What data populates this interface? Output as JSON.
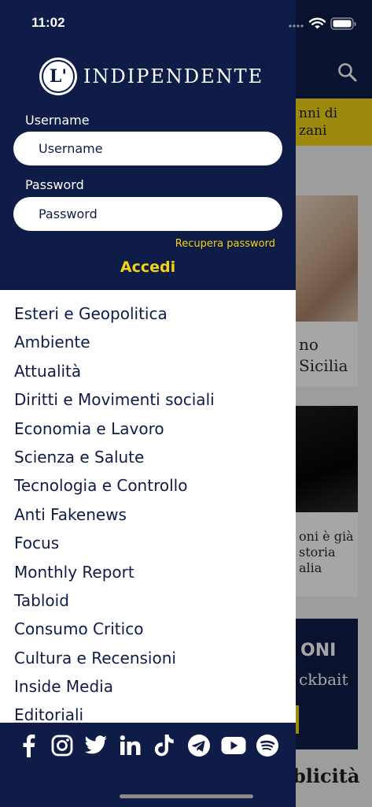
{
  "status_bar": {
    "time": "11:02"
  },
  "drawer": {
    "logo": {
      "mark": "L'",
      "text": "INDIPENDENTE"
    },
    "login": {
      "username_label": "Username",
      "username_placeholder": "Username",
      "password_label": "Password",
      "password_placeholder": "Password",
      "recover_label": "Recupera password",
      "submit_label": "Accedi"
    },
    "menu_items": [
      "Esteri e Geopolitica",
      "Ambiente",
      "Attualità",
      "Diritti e Movimenti sociali",
      "Economia e Lavoro",
      "Scienza e Salute",
      "Tecnologia e Controllo",
      "Anti Fakenews",
      "Focus",
      "Monthly Report",
      "Tabloid",
      "Consumo Critico",
      "Cultura e Recensioni",
      "Inside Media",
      "Editoriali"
    ],
    "social_icons": [
      "facebook-icon",
      "instagram-icon",
      "twitter-icon",
      "linkedin-icon",
      "tiktok-icon",
      "telegram-icon",
      "youtube-icon",
      "spotify-icon"
    ]
  },
  "background": {
    "banner_text": [
      "nni di",
      "zani"
    ],
    "card1_title": [
      "no",
      "Sicilia"
    ],
    "card2_title": [
      "oni è già",
      "storia",
      "alia"
    ],
    "promo_title": "ONI",
    "promo_sub": "ckbait",
    "bottom_text": "blicità"
  },
  "colors": {
    "navy": "#0f1c48",
    "accent_yellow": "#f2d316",
    "white": "#ffffff"
  }
}
